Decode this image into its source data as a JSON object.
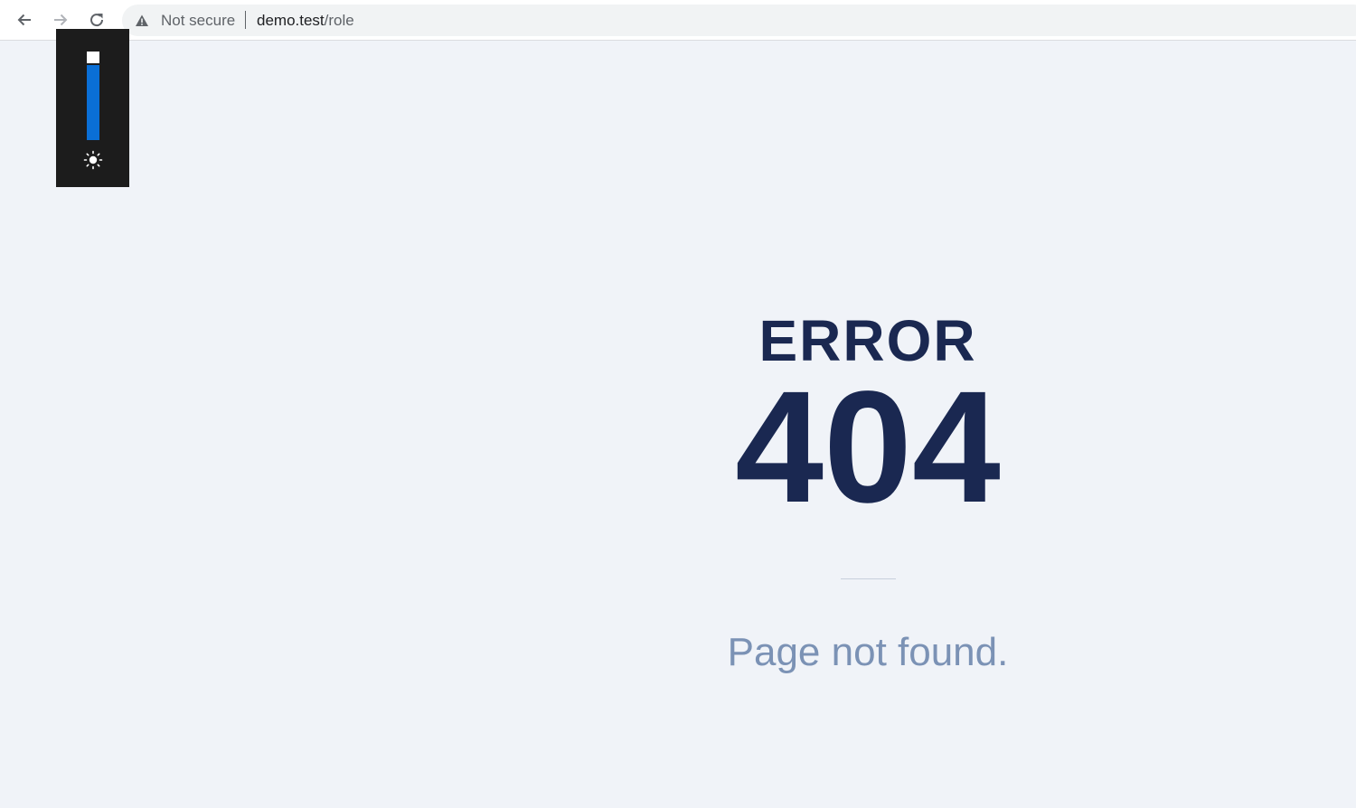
{
  "browser": {
    "security_label": "Not secure",
    "url_host": "demo.test",
    "url_path": "/role"
  },
  "brightness": {
    "level": 0.85,
    "icon": "sun-icon"
  },
  "error": {
    "title": "ERROR",
    "code": "404",
    "message": "Page not found."
  },
  "colors": {
    "page_background": "#f0f3f8",
    "heading": "#1a2851",
    "message": "#7b92b5",
    "brightness_fill": "#0a6fd6"
  }
}
